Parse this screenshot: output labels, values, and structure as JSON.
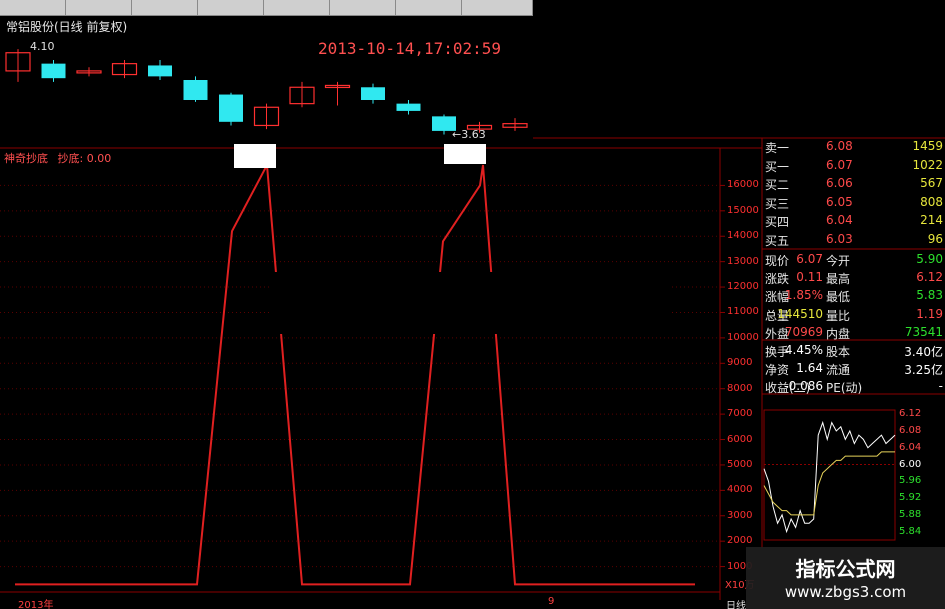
{
  "chart_title": "常铝股份(日线 前复权)",
  "datetime": "2013-10-14,17:02:59",
  "price_top_marker": "4.10",
  "price_low_marker": "←3.63",
  "indicator": {
    "name": "神奇抄底",
    "value_label": "抄底: 0.00"
  },
  "x_axis": {
    "left_label": "2013年",
    "mid_tick": "9",
    "right_label": "X10万"
  },
  "y_axis_ticks": [
    "16000",
    "15000",
    "14000",
    "13000",
    "12000",
    "11000",
    "10000",
    "9000",
    "8000",
    "7000",
    "6000",
    "5000",
    "4000",
    "3000",
    "2000",
    "1000"
  ],
  "order_book": [
    {
      "label": "卖一",
      "price": "6.08",
      "volume": "1459"
    },
    {
      "label": "买一",
      "price": "6.07",
      "volume": "1022"
    },
    {
      "label": "买二",
      "price": "6.06",
      "volume": "567"
    },
    {
      "label": "买三",
      "price": "6.05",
      "volume": "808"
    },
    {
      "label": "买四",
      "price": "6.04",
      "volume": "214"
    },
    {
      "label": "买五",
      "price": "6.03",
      "volume": "96"
    }
  ],
  "stats": [
    {
      "l1": "现价",
      "v1": "6.07",
      "c1": "red",
      "l2": "今开",
      "v2": "5.90",
      "c2": "green"
    },
    {
      "l1": "涨跌",
      "v1": "0.11",
      "c1": "red",
      "l2": "最高",
      "v2": "6.12",
      "c2": "red"
    },
    {
      "l1": "涨幅",
      "v1": "1.85%",
      "c1": "red",
      "l2": "最低",
      "v2": "5.83",
      "c2": "green"
    },
    {
      "l1": "总量",
      "v1": "144510",
      "c1": "yellow",
      "l2": "量比",
      "v2": "1.19",
      "c2": "red"
    },
    {
      "l1": "外盘",
      "v1": "70969",
      "c1": "red",
      "l2": "内盘",
      "v2": "73541",
      "c2": "green"
    },
    {
      "l1": "换手",
      "v1": "4.45%",
      "c1": "white",
      "l2": "股本",
      "v2": "3.40亿",
      "c2": "white"
    },
    {
      "l1": "净资",
      "v1": "1.64",
      "c1": "white",
      "l2": "流通",
      "v2": "3.25亿",
      "c2": "white"
    },
    {
      "l1": "收益(二)",
      "v1": "-0.086",
      "c1": "white",
      "l2": "PE(动)",
      "v2": "-",
      "c2": "white"
    }
  ],
  "intraday_ticks": [
    {
      "text": "6.12",
      "color": "red"
    },
    {
      "text": "6.08",
      "color": "red"
    },
    {
      "text": "6.04",
      "color": "red"
    },
    {
      "text": "6.00",
      "color": "white"
    },
    {
      "text": "5.96",
      "color": "green"
    },
    {
      "text": "5.92",
      "color": "green"
    },
    {
      "text": "5.88",
      "color": "green"
    },
    {
      "text": "5.84",
      "color": "green"
    }
  ],
  "watermark": {
    "line1": "指标公式网",
    "line2": "www.zbgs3.com"
  },
  "bottom_right_tab": "日线",
  "colors": {
    "up": "#ff3030",
    "down": "#30e8f0",
    "indicator_line": "#e02020",
    "grid": "#5a0000"
  },
  "chart_data": {
    "type": "line",
    "title": "",
    "x": [
      0,
      1,
      2,
      3,
      4,
      5,
      6,
      7,
      8,
      9,
      10,
      11,
      12,
      13,
      14,
      15,
      16,
      17,
      18,
      19
    ],
    "series": [
      {
        "name": "",
        "values": [
          300,
          300,
          300,
          300,
          14200,
          16800,
          300,
          300,
          300,
          300,
          300,
          300,
          300,
          300,
          300,
          13800,
          16000,
          16800,
          300,
          300
        ]
      }
    ],
    "ylim": [
      0,
      17000
    ],
    "grid": true,
    "candles": [
      {
        "o": 3.98,
        "c": 4.08,
        "h": 4.1,
        "l": 3.92
      },
      {
        "o": 4.02,
        "c": 3.94,
        "h": 4.04,
        "l": 3.92
      },
      {
        "o": 3.97,
        "c": 3.98,
        "h": 4.0,
        "l": 3.95
      },
      {
        "o": 3.96,
        "c": 4.02,
        "h": 4.04,
        "l": 3.94
      },
      {
        "o": 4.01,
        "c": 3.95,
        "h": 4.04,
        "l": 3.93
      },
      {
        "o": 3.93,
        "c": 3.82,
        "h": 3.95,
        "l": 3.81
      },
      {
        "o": 3.85,
        "c": 3.7,
        "h": 3.86,
        "l": 3.68
      },
      {
        "o": 3.68,
        "c": 3.78,
        "h": 3.8,
        "l": 3.66
      },
      {
        "o": 3.8,
        "c": 3.89,
        "h": 3.92,
        "l": 3.78
      },
      {
        "o": 3.9,
        "c": 3.9,
        "h": 3.92,
        "l": 3.79
      },
      {
        "o": 3.89,
        "c": 3.82,
        "h": 3.91,
        "l": 3.8
      },
      {
        "o": 3.8,
        "c": 3.76,
        "h": 3.82,
        "l": 3.74
      },
      {
        "o": 3.73,
        "c": 3.65,
        "h": 3.74,
        "l": 3.63
      },
      {
        "o": 3.66,
        "c": 3.68,
        "h": 3.7,
        "l": 3.64
      },
      {
        "o": 3.67,
        "c": 3.69,
        "h": 3.72,
        "l": 3.65
      }
    ],
    "candle_ylim": [
      3.6,
      4.15
    ],
    "intraday_price": [
      5.99,
      5.96,
      5.9,
      5.86,
      5.88,
      5.84,
      5.87,
      5.85,
      5.89,
      5.86,
      5.86,
      5.87,
      6.07,
      6.1,
      6.06,
      6.1,
      6.08,
      6.09,
      6.06,
      6.08,
      6.05,
      6.07,
      6.06,
      6.04,
      6.05,
      6.06,
      6.07,
      6.05,
      6.06,
      6.07
    ],
    "intraday_avg": [
      5.95,
      5.93,
      5.91,
      5.9,
      5.89,
      5.89,
      5.88,
      5.88,
      5.88,
      5.88,
      5.88,
      5.88,
      5.95,
      5.98,
      5.99,
      6.0,
      6.01,
      6.01,
      6.02,
      6.02,
      6.02,
      6.02,
      6.02,
      6.02,
      6.02,
      6.02,
      6.03,
      6.03,
      6.03,
      6.03
    ],
    "intraday_ylim": [
      5.82,
      6.13
    ]
  }
}
